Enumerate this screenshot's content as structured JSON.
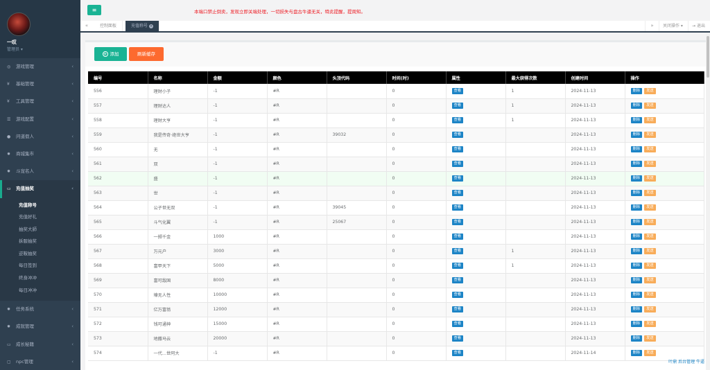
{
  "user": {
    "name": "一叹",
    "role": "管理员 ▾"
  },
  "sidebar": {
    "items": [
      {
        "icon": "gamepad-icon",
        "glyph": "◎",
        "label": "游戏管理"
      },
      {
        "icon": "fork-knife-icon",
        "glyph": "¥",
        "label": "基础管理"
      },
      {
        "icon": "tools-icon",
        "glyph": "¥",
        "label": "工具管理"
      },
      {
        "icon": "list-icon",
        "glyph": "☰",
        "label": "游戏配置"
      },
      {
        "icon": "user-icon",
        "glyph": "●",
        "label": "问道假人"
      },
      {
        "icon": "gear-icon",
        "glyph": "✹",
        "label": "商城集市"
      },
      {
        "icon": "gear-icon",
        "glyph": "✹",
        "label": "斗宠名人"
      },
      {
        "icon": "card-icon",
        "glyph": "▭",
        "label": "充值抽奖",
        "active": true
      }
    ],
    "sub_items": [
      "充值称号",
      "充值好礼",
      "抽奖大師",
      "拆服抽奖",
      "逆鞍抽奖",
      "每日签到",
      "终身冲冲",
      "每日冲冲"
    ],
    "items_after": [
      {
        "icon": "gear-icon",
        "glyph": "✹",
        "label": "任务系统"
      },
      {
        "icon": "gear-icon",
        "glyph": "✹",
        "label": "成就管理"
      },
      {
        "icon": "card-icon",
        "glyph": "▭",
        "label": "成长秘籍"
      },
      {
        "icon": "square-icon",
        "glyph": "▢",
        "label": "npc管理"
      }
    ]
  },
  "topbar": {
    "notice": "本端口禁止倒卖，发现立即关端处理，一切损失与盘古牛逼无关，特此提醒，提周知。"
  },
  "tabs": {
    "items": [
      {
        "label": "控制面板"
      },
      {
        "label": "充值称号"
      }
    ],
    "close_ops": "关闭操作 ▾",
    "logout": "退出"
  },
  "toolbar": {
    "add_label": "添加",
    "refresh_label": "刷新缓存"
  },
  "table": {
    "headers": [
      "编号",
      "名称",
      "金额",
      "颜色",
      "头顶代码",
      "时间(时)",
      "属性",
      "最大获得次数",
      "创建时间",
      "操作"
    ],
    "view_label": "查看",
    "del_label": "删除",
    "send_label": "发送",
    "rows": [
      [
        "556",
        "理财小子",
        "-1",
        "#R",
        "",
        "0",
        "1",
        "2024-11-13"
      ],
      [
        "557",
        "理财达人",
        "-1",
        "#R",
        "",
        "0",
        "1",
        "2024-11-13"
      ],
      [
        "558",
        "理财大亨",
        "-1",
        "#R",
        "",
        "0",
        "1",
        "2024-11-13"
      ],
      [
        "559",
        "我是传奇·绝世大亨",
        "-1",
        "#R",
        "39032",
        "0",
        "",
        "2024-11-13"
      ],
      [
        "560",
        "无",
        "-1",
        "#R",
        "",
        "0",
        "",
        "2024-11-13"
      ],
      [
        "561",
        "双",
        "-1",
        "#R",
        "",
        "0",
        "",
        "2024-11-13"
      ],
      [
        "562",
        "盛",
        "-1",
        "#R",
        "",
        "0",
        "",
        "2024-11-13"
      ],
      [
        "563",
        "世",
        "-1",
        "#R",
        "",
        "0",
        "",
        "2024-11-13"
      ],
      [
        "564",
        "公子世无双",
        "-1",
        "#R",
        "39045",
        "0",
        "",
        "2024-11-13"
      ],
      [
        "565",
        "斗气化翼",
        "-1",
        "#R",
        "25067",
        "0",
        "",
        "2024-11-13"
      ],
      [
        "566",
        "一掷千金",
        "1000",
        "#R",
        "",
        "0",
        "",
        "2024-11-13"
      ],
      [
        "567",
        "万元户",
        "3000",
        "#R",
        "",
        "0",
        "1",
        "2024-11-13"
      ],
      [
        "568",
        "富甲天下",
        "5000",
        "#R",
        "",
        "0",
        "1",
        "2024-11-13"
      ],
      [
        "569",
        "富可敌国",
        "8000",
        "#R",
        "",
        "0",
        "",
        "2024-11-13"
      ],
      [
        "570",
        "壕无人性",
        "10000",
        "#R",
        "",
        "0",
        "",
        "2024-11-13"
      ],
      [
        "571",
        "亿万富翁",
        "12000",
        "#R",
        "",
        "0",
        "",
        "2024-11-13"
      ],
      [
        "572",
        "钱可通神",
        "15000",
        "#R",
        "",
        "0",
        "",
        "2024-11-13"
      ],
      [
        "573",
        "地撒马云",
        "20000",
        "#R",
        "",
        "0",
        "",
        "2024-11-13"
      ],
      [
        "574",
        "一代…世阿大",
        "-1",
        "#R",
        "",
        "0",
        "",
        "2024-11-14"
      ]
    ]
  },
  "footer": {
    "text": "叶鼎 后台管理 牛逼"
  }
}
